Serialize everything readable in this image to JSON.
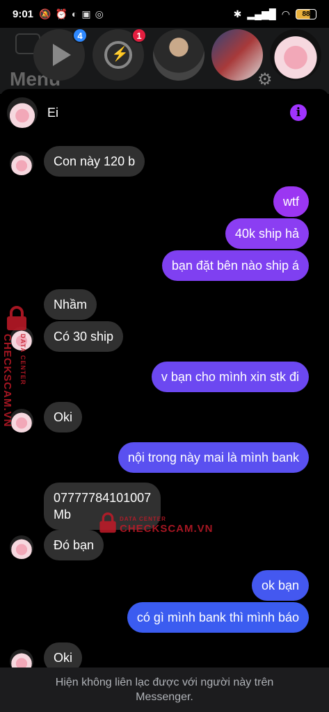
{
  "status_bar": {
    "time": "9:01",
    "battery": "88"
  },
  "background_app": {
    "menu_title": "Menu"
  },
  "chat_heads": {
    "video_badge": "4",
    "messenger_badge": "1"
  },
  "chat": {
    "contact_name": "Ei",
    "messages": [
      {
        "dir": "in",
        "text": "Con này 120 b"
      },
      {
        "dir": "out",
        "text": "wtf"
      },
      {
        "dir": "out",
        "text": "40k ship hả"
      },
      {
        "dir": "out",
        "text": "bạn đặt bên nào ship á"
      },
      {
        "dir": "in",
        "text": "Nhầm"
      },
      {
        "dir": "in",
        "text": "Có 30 ship"
      },
      {
        "dir": "out",
        "text": "v bạn cho mình xin stk đi"
      },
      {
        "dir": "in",
        "text": "Oki"
      },
      {
        "dir": "out",
        "text": "nội trong này mai là mình bank"
      },
      {
        "dir": "in",
        "text": "07777784101007\nMb"
      },
      {
        "dir": "in",
        "text": "Đó bạn"
      },
      {
        "dir": "out",
        "text": "ok bạn"
      },
      {
        "dir": "out",
        "text": "có gì mình bank thì mình báo"
      },
      {
        "dir": "in",
        "text": "Oki"
      }
    ],
    "footer_notice": "Hiện không liên lạc được với người này trên Messenger."
  },
  "watermark": {
    "brand": "CHECKSCAM.VN",
    "sub": "DATA CENTER"
  },
  "colors": {
    "outgoing_bubble_top": "#9b36f2",
    "outgoing_bubble_bottom": "#3b5cf0",
    "incoming_bubble": "#303030",
    "info_icon": "#a033ff"
  }
}
